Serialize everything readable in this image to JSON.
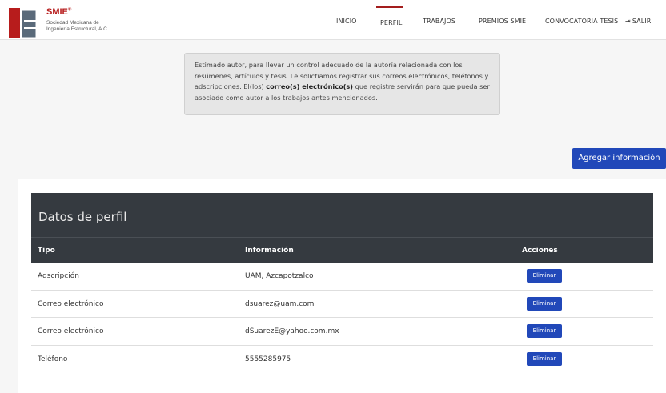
{
  "brand": {
    "name": "SMIE",
    "mark": "®",
    "subtitle_line1": "Sociedad Mexicana de",
    "subtitle_line2": "Ingeniería Estructural, A.C.",
    "color": "#b71c1c"
  },
  "nav": {
    "items": [
      {
        "label": "INICIO"
      },
      {
        "label": "PERFIL"
      },
      {
        "label": "TRABAJOS"
      },
      {
        "label": "PREMIOS SMIE"
      },
      {
        "label": "CONVOCATORIA TESIS"
      },
      {
        "label": "SALIR"
      }
    ],
    "active_index": 1,
    "active_color": "#a31d1d"
  },
  "notice": {
    "text_before": "Estimado autor, para llevar un control adecuado de la autoría relacionada con los resúmenes, artículos y tesis. Le solictiamos registrar sus correos electrónicos, teléfonos y adscripciones. El(los) ",
    "bold": "correo(s) electrónico(s)",
    "text_after": " que registre servirán para que pueda ser asociado como autor a los trabajos antes mencionados."
  },
  "actions": {
    "add_label": "Agregar información",
    "accent": "#2148b9"
  },
  "table": {
    "title": "Datos de perfil",
    "headers": {
      "tipo": "Tipo",
      "info": "Información",
      "acciones": "Acciones"
    },
    "rows": [
      {
        "tipo": "Adscripción",
        "info": "UAM, Azcapotzalco",
        "action": "Eliminar"
      },
      {
        "tipo": "Correo electrónico",
        "info": "dsuarez@uam.com",
        "action": "Eliminar"
      },
      {
        "tipo": "Correo electrónico",
        "info": "dSuarezE@yahoo.com.mx",
        "action": "Eliminar"
      },
      {
        "tipo": "Teléfono",
        "info": "5555285975",
        "action": "Eliminar"
      }
    ],
    "header_bg": "#353a40"
  }
}
